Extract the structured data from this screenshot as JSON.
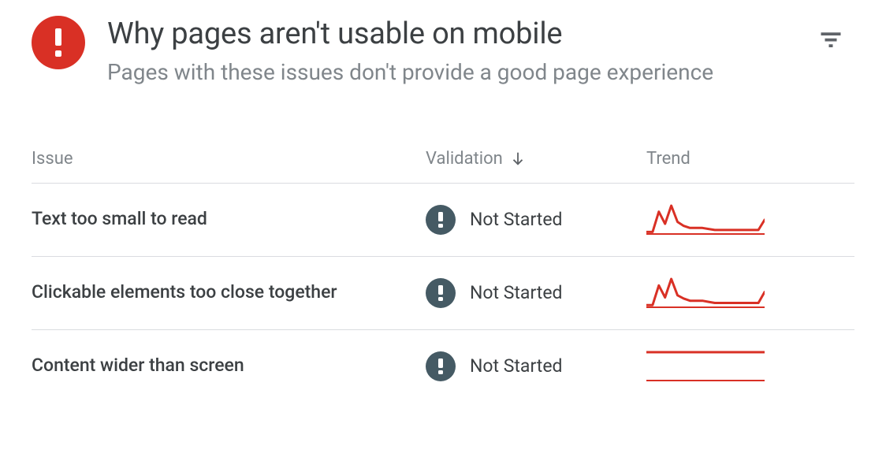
{
  "header": {
    "title": "Why pages aren't usable on mobile",
    "subtitle": "Pages with these issues don't provide a good page experience"
  },
  "table": {
    "columns": {
      "issue": "Issue",
      "validation": "Validation",
      "trend": "Trend"
    },
    "sort": {
      "column": "validation",
      "direction": "desc"
    }
  },
  "rows": [
    {
      "issue": "Text too small to read",
      "validation_status": "Not Started",
      "trend": [
        2,
        2,
        22,
        10,
        28,
        12,
        8,
        6,
        6,
        6,
        5,
        4,
        4,
        4,
        4,
        4,
        4,
        4,
        4,
        14
      ]
    },
    {
      "issue": "Clickable elements too close together",
      "validation_status": "Not Started",
      "trend": [
        2,
        2,
        20,
        9,
        26,
        11,
        8,
        6,
        6,
        6,
        5,
        4,
        4,
        4,
        4,
        4,
        4,
        4,
        4,
        14
      ]
    },
    {
      "issue": "Content wider than screen",
      "validation_status": "Not Started",
      "trend": [
        1,
        1,
        1,
        1,
        1,
        1,
        1,
        1,
        1,
        1,
        1,
        1,
        1,
        1,
        1,
        1,
        1,
        1,
        1,
        1
      ]
    }
  ],
  "colors": {
    "error": "#d93025",
    "status_dot": "#455a64",
    "sparkline": "#d93025"
  }
}
